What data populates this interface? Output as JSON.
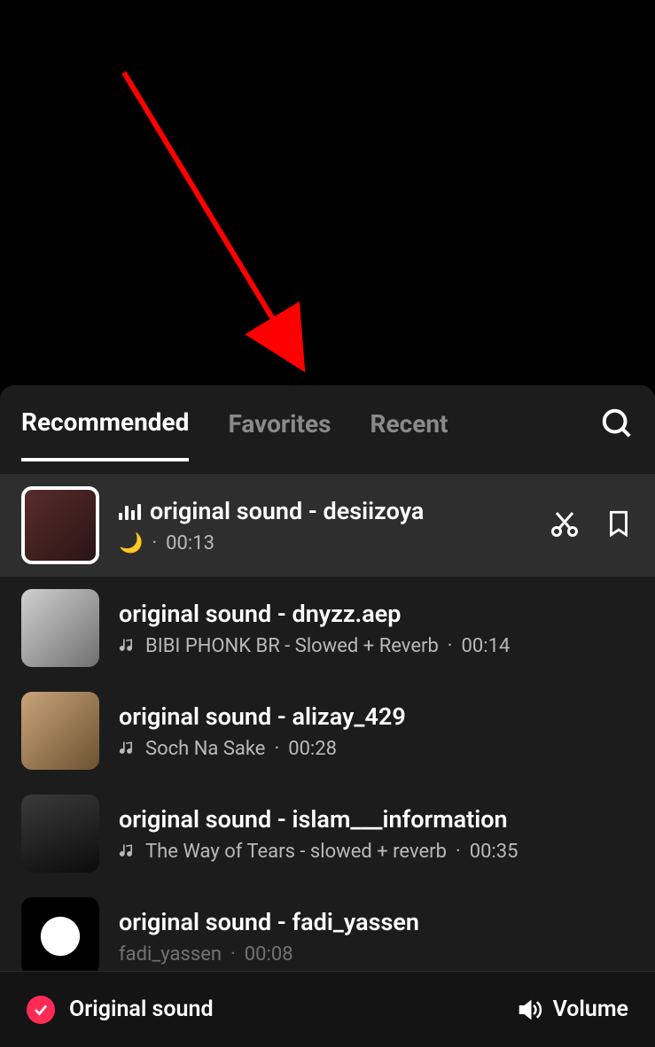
{
  "tabs": {
    "recommended": "Recommended",
    "favorites": "Favorites",
    "recent": "Recent",
    "active": "recommended"
  },
  "sounds": [
    {
      "title": "original sound - desiizoya",
      "sub_icon": "🌙",
      "subtitle": "",
      "duration": "00:13",
      "playing": true,
      "selected": true
    },
    {
      "title": "original sound - dnyzz.aep",
      "subtitle": "BIBI PHONK BR - Slowed + Reverb",
      "duration": "00:14"
    },
    {
      "title": "original sound - alizay_429",
      "subtitle": "Soch Na Sake",
      "duration": "00:28"
    },
    {
      "title": "original sound - islam___information",
      "subtitle": "The Way of Tears - slowed + reverb",
      "duration": "00:35"
    },
    {
      "title": "original sound - fadi_yassen",
      "subtitle": "fadi_yassen",
      "duration": "00:08"
    }
  ],
  "footer": {
    "label": "Original sound",
    "volume": "Volume"
  }
}
